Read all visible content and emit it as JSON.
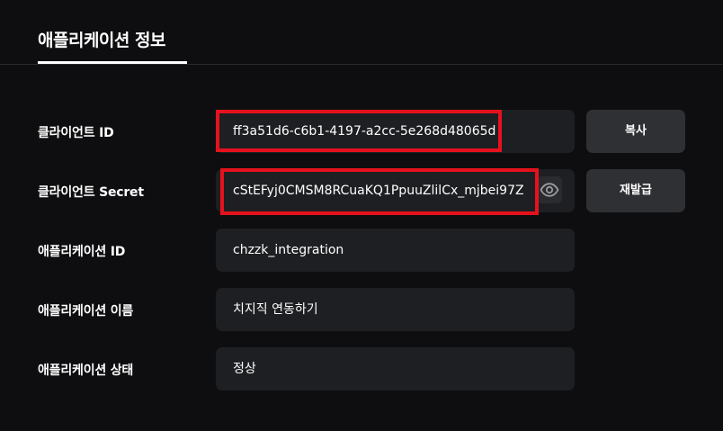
{
  "tab": {
    "title": "애플리케이션 정보"
  },
  "rows": [
    {
      "label": "클라이언트 ID",
      "value": "ff3a51d6-c6b1-4197-a2cc-5e268d48065d"
    },
    {
      "label": "클라이언트 Secret",
      "value": "cStEFyj0CMSM8RCuaKQ1PpuuZlilCx_mjbei97Z"
    },
    {
      "label": "애플리케이션 ID",
      "value": "chzzk_integration"
    },
    {
      "label": "애플리케이션 이름",
      "value": "치지직 연동하기"
    },
    {
      "label": "애플리케이션 상태",
      "value": "정상"
    }
  ],
  "buttons": {
    "copy_label": "복사",
    "reissue_label": "재발급"
  },
  "icons": {
    "secret_toggle": "eye-icon"
  },
  "colors": {
    "background": "#0e0e10",
    "field_bg": "#1e1f22",
    "button_bg": "#2f3033",
    "highlight": "#e5121d"
  }
}
